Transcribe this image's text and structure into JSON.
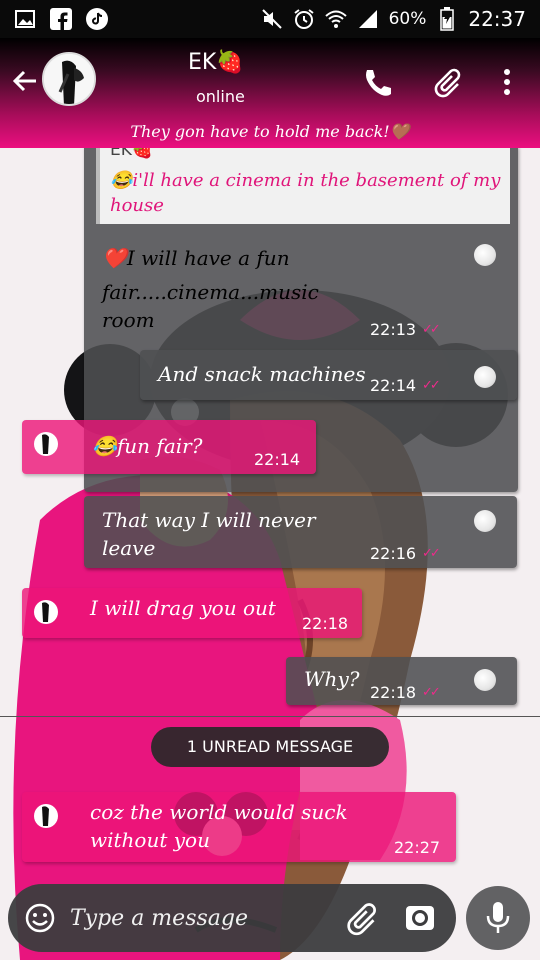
{
  "status_bar": {
    "battery": "60%",
    "time": "22:37",
    "icons": [
      "image-icon",
      "facebook-icon",
      "tiktok-icon",
      "mute-icon",
      "alarm-icon",
      "wifi-icon",
      "signal-icon",
      "battery-icon"
    ]
  },
  "header": {
    "contact_name": "EK🍓",
    "status": "online",
    "about": "They gon have to hold me back!🤎",
    "icons": [
      "back-arrow-icon",
      "phone-icon",
      "attach-icon",
      "more-vert-icon"
    ]
  },
  "quote": {
    "author": "EK🍓",
    "text": "😂i'll have a cinema in the basement of my house"
  },
  "messages": [
    {
      "direction": "out",
      "line1": "❤️I will have a fun",
      "line2": "fair.....cinema...music",
      "line3": "room",
      "time": "22:13",
      "ticks": "✓✓"
    },
    {
      "direction": "out",
      "text": "And snack machines",
      "time": "22:14",
      "ticks": "✓✓"
    },
    {
      "direction": "in",
      "text": "😂fun fair?",
      "time": "22:14"
    },
    {
      "direction": "out",
      "line1": "That way I will never",
      "line2": "leave",
      "time": "22:16",
      "ticks": "✓✓"
    },
    {
      "direction": "in",
      "text": "I will drag you out",
      "time": "22:18"
    },
    {
      "direction": "out",
      "text": "Why?",
      "time": "22:18",
      "ticks": "✓✓"
    },
    {
      "direction": "in",
      "line1": "coz the world would suck",
      "line2": "without you",
      "time": "22:27"
    }
  ],
  "unread_label": "1 UNREAD MESSAGE",
  "composer": {
    "placeholder": "Type a message",
    "icons": [
      "emoji-icon",
      "attach-icon",
      "camera-icon",
      "mic-icon"
    ]
  },
  "colors": {
    "accent": "#ec0f80",
    "outgoing_bubble": "#4e5052",
    "incoming_bubble": "#ec1478"
  }
}
